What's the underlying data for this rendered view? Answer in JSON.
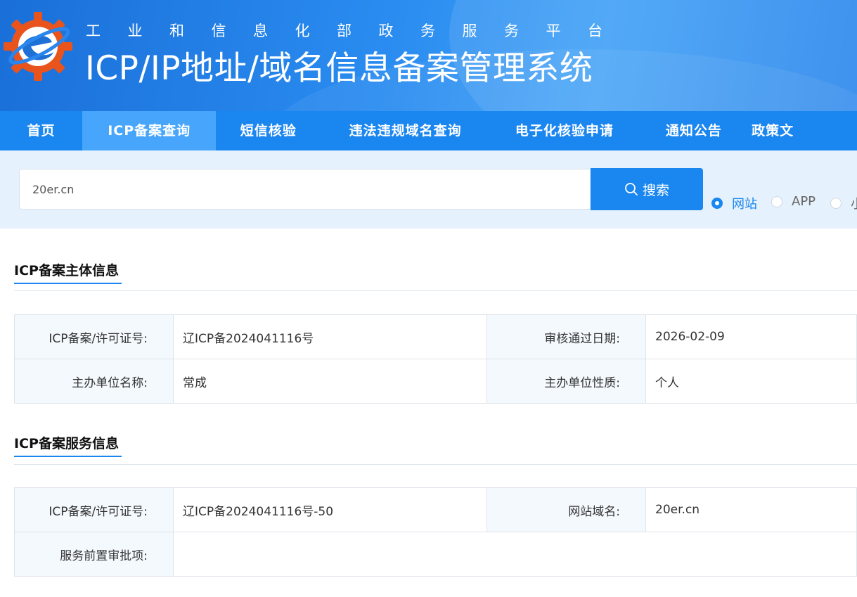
{
  "header": {
    "subtitle": "工业和信息化部政务服务平台",
    "title": "ICP/IP地址/域名信息备案管理系统"
  },
  "nav": {
    "items": [
      {
        "label": "首页",
        "active": false
      },
      {
        "label": "ICP备案查询",
        "active": true
      },
      {
        "label": "短信核验",
        "active": false
      },
      {
        "label": "违法违规域名查询",
        "active": false
      },
      {
        "label": "电子化核验申请",
        "active": false
      },
      {
        "label": "通知公告",
        "active": false
      },
      {
        "label": "政策文",
        "active": false
      }
    ]
  },
  "search": {
    "value": "20er.cn",
    "button_label": "搜索",
    "button_icon": "search-icon",
    "options": [
      {
        "label": "网站",
        "selected": true
      },
      {
        "label": "APP",
        "selected": false
      },
      {
        "label": "小",
        "selected": false
      }
    ]
  },
  "subject_info": {
    "title": "ICP备案主体信息",
    "license_label": "ICP备案/许可证号:",
    "license_value": "辽ICP备2024041116号",
    "approve_date_label": "审核通过日期:",
    "approve_date_value": "2026-02-09",
    "org_name_label": "主办单位名称:",
    "org_name_value": "常成",
    "org_type_label": "主办单位性质:",
    "org_type_value": "个人"
  },
  "service_info": {
    "title": "ICP备案服务信息",
    "license_label": "ICP备案/许可证号:",
    "license_value": "辽ICP备2024041116号-50",
    "domain_label": "网站域名:",
    "domain_value": "20er.cn",
    "preapproval_label": "服务前置审批项:",
    "preapproval_value": ""
  },
  "colors": {
    "primary": "#1a86f0",
    "nav_active": "#47a6fb",
    "search_strip_bg": "#e5f1fc",
    "label_cell_bg": "#f4f9fe"
  }
}
